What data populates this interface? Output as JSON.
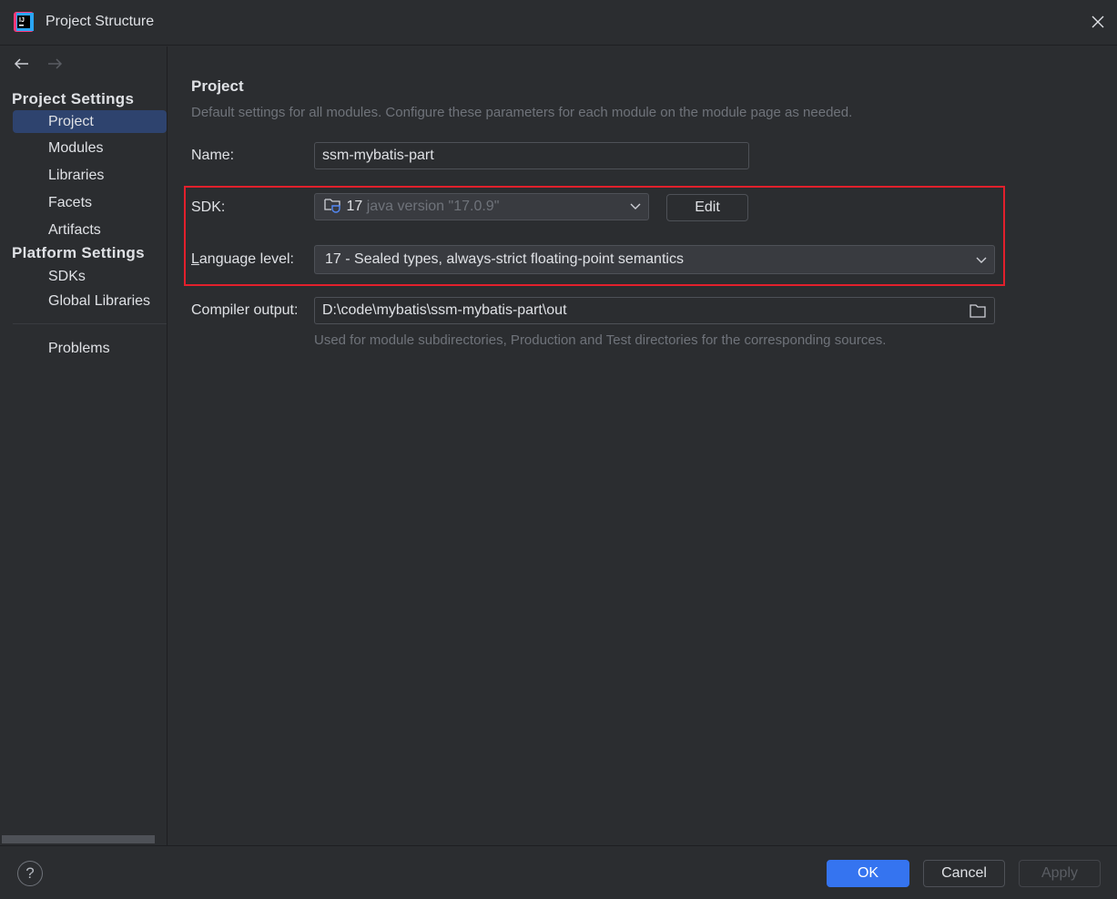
{
  "window": {
    "title": "Project Structure"
  },
  "sidebar": {
    "section_project": "Project Settings",
    "section_platform": "Platform Settings",
    "items": [
      {
        "label": "Project",
        "selected": true
      },
      {
        "label": "Modules"
      },
      {
        "label": "Libraries"
      },
      {
        "label": "Facets"
      },
      {
        "label": "Artifacts"
      }
    ],
    "platform_items": [
      {
        "label": "SDKs"
      },
      {
        "label": "Global Libraries"
      }
    ],
    "problems": "Problems"
  },
  "main": {
    "heading": "Project",
    "description": "Default settings for all modules. Configure these parameters for each module on the module page as needed.",
    "name_label": "Name:",
    "name_value": "ssm-mybatis-part",
    "sdk_label": "SDK:",
    "sdk_version": "17",
    "sdk_detail": "java version \"17.0.9\"",
    "edit_label": "Edit",
    "language_label_mnemonic": "L",
    "language_label_rest": "anguage level:",
    "language_value": "17 - Sealed types, always-strict floating-point semantics",
    "compiler_label": "Compiler output:",
    "compiler_value": "D:\\code\\mybatis\\ssm-mybatis-part\\out",
    "compiler_hint": "Used for module subdirectories, Production and Test directories for the corresponding sources.",
    "highlight_color": "#e3202c"
  },
  "footer": {
    "help": "?",
    "ok": "OK",
    "cancel": "Cancel",
    "apply": "Apply",
    "accent": "#3574f0"
  }
}
